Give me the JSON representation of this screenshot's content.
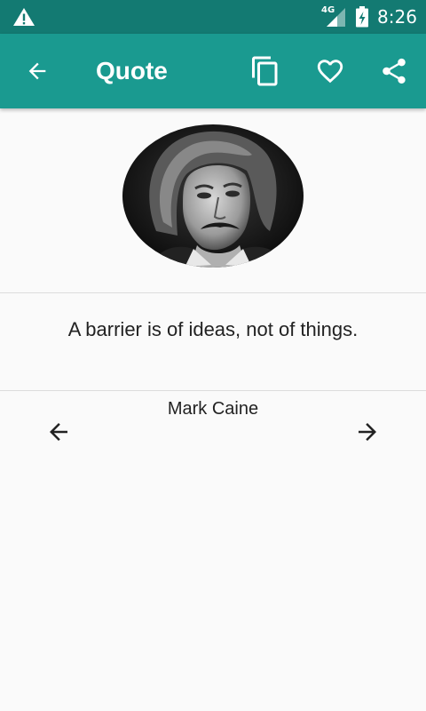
{
  "status_bar": {
    "network": "4G",
    "time": "8:26"
  },
  "app_bar": {
    "title": "Quote",
    "icons": {
      "back": "arrow-back-icon",
      "copy": "copy-icon",
      "favorite": "heart-outline-icon",
      "share": "share-icon"
    }
  },
  "quote": {
    "text": "A barrier is of ideas, not of things.",
    "author": "Mark Caine"
  },
  "navigation": {
    "previous_icon": "arrow-left-icon",
    "next_icon": "arrow-right-icon"
  },
  "colors": {
    "status_bar": "#137a72",
    "app_bar": "#1a9a90",
    "background": "#fafafa",
    "text": "#222222"
  }
}
